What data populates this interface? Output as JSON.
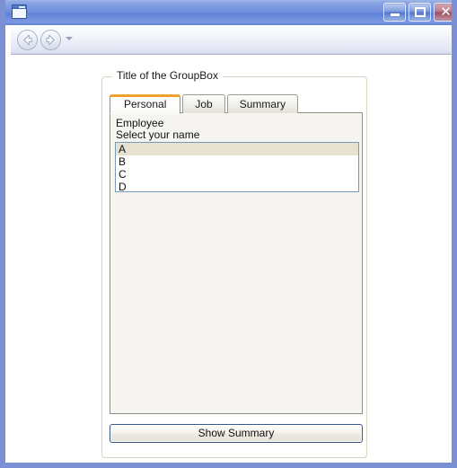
{
  "window": {
    "title": "",
    "icon": "application-window-icon",
    "frame_color": "#7b8fd4",
    "titlebar_gradient_top": "#9fb6e8",
    "titlebar_gradient_bottom": "#5f7fd2"
  },
  "caption_buttons": {
    "minimize_label": "–",
    "maximize_label": "□",
    "close_label": "✕"
  },
  "navbar": {
    "back_label": "Back",
    "forward_label": "Forward",
    "history_dropdown_label": ""
  },
  "groupbox": {
    "title": "Title of the GroupBox",
    "border_color": "#d8d4c2"
  },
  "tabs": {
    "active_index": 0,
    "active_accent_color": "#eb9b20",
    "items": [
      {
        "label": "Personal"
      },
      {
        "label": "Job"
      },
      {
        "label": "Summary"
      }
    ]
  },
  "personal_tab": {
    "heading": "Employee",
    "instruction": "Select your name",
    "listbox": {
      "selected_value": "A",
      "selection_color": "#e6e2d2",
      "options": [
        {
          "label": "A",
          "selected": true
        },
        {
          "label": "B",
          "selected": false
        },
        {
          "label": "C",
          "selected": false
        },
        {
          "label": "D",
          "selected": false
        }
      ]
    }
  },
  "actions": {
    "show_summary_label": "Show Summary"
  }
}
